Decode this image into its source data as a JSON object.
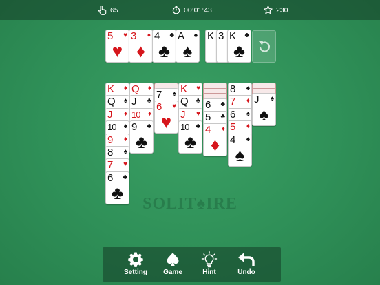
{
  "status": {
    "moves": "65",
    "timer": "00:01:43",
    "score": "230"
  },
  "foundations": [
    {
      "rank": "5",
      "suit": "♥",
      "color": "red"
    },
    {
      "rank": "3",
      "suit": "♦",
      "color": "red"
    },
    {
      "rank": "4",
      "suit": "♣",
      "color": "black"
    },
    {
      "rank": "A",
      "suit": "♠",
      "color": "black"
    }
  ],
  "waste": [
    {
      "rank": "K",
      "suit": "♠",
      "color": "black"
    },
    {
      "rank": "3",
      "suit": "♠",
      "color": "black"
    },
    {
      "rank": "K",
      "suit": "♣",
      "color": "black"
    }
  ],
  "tableau": [
    {
      "hidden": 0,
      "cards": [
        {
          "rank": "K",
          "suit": "♦",
          "color": "red"
        },
        {
          "rank": "Q",
          "suit": "♠",
          "color": "black"
        },
        {
          "rank": "J",
          "suit": "♦",
          "color": "red"
        },
        {
          "rank": "10",
          "suit": "♠",
          "color": "black"
        },
        {
          "rank": "9",
          "suit": "♦",
          "color": "red"
        },
        {
          "rank": "8",
          "suit": "♠",
          "color": "black"
        },
        {
          "rank": "7",
          "suit": "♥",
          "color": "red"
        },
        {
          "rank": "6",
          "suit": "♣",
          "color": "black"
        }
      ]
    },
    {
      "hidden": 0,
      "cards": [
        {
          "rank": "Q",
          "suit": "♦",
          "color": "red"
        },
        {
          "rank": "J",
          "suit": "♣",
          "color": "black"
        },
        {
          "rank": "10",
          "suit": "♦",
          "color": "red"
        },
        {
          "rank": "9",
          "suit": "♣",
          "color": "black"
        }
      ]
    },
    {
      "hidden": 1,
      "cards": [
        {
          "rank": "7",
          "suit": "♠",
          "color": "black"
        },
        {
          "rank": "6",
          "suit": "♥",
          "color": "red"
        }
      ]
    },
    {
      "hidden": 0,
      "cards": [
        {
          "rank": "K",
          "suit": "♥",
          "color": "red"
        },
        {
          "rank": "Q",
          "suit": "♣",
          "color": "black"
        },
        {
          "rank": "J",
          "suit": "♥",
          "color": "red"
        },
        {
          "rank": "10",
          "suit": "♣",
          "color": "black"
        }
      ]
    },
    {
      "hidden": 3,
      "cards": [
        {
          "rank": "6",
          "suit": "♣",
          "color": "black"
        },
        {
          "rank": "5",
          "suit": "♣",
          "color": "black"
        },
        {
          "rank": "4",
          "suit": "♦",
          "color": "red"
        }
      ]
    },
    {
      "hidden": 0,
      "cards": [
        {
          "rank": "8",
          "suit": "♠",
          "color": "black"
        },
        {
          "rank": "7",
          "suit": "♦",
          "color": "red"
        },
        {
          "rank": "6",
          "suit": "♠",
          "color": "black"
        },
        {
          "rank": "5",
          "suit": "♦",
          "color": "red"
        },
        {
          "rank": "4",
          "suit": "♠",
          "color": "black"
        }
      ]
    },
    {
      "hidden": 2,
      "cards": [
        {
          "rank": "J",
          "suit": "♠",
          "color": "black"
        }
      ]
    }
  ],
  "watermark": "SOLIT♠IRE",
  "toolbar": [
    {
      "id": "setting",
      "label": "Setting",
      "icon": "gear-icon"
    },
    {
      "id": "game",
      "label": "Game",
      "icon": "spade-icon"
    },
    {
      "id": "hint",
      "label": "Hint",
      "icon": "lightbulb-icon"
    },
    {
      "id": "undo",
      "label": "Undo",
      "icon": "undo-arrow-icon"
    }
  ],
  "colors": {
    "felt": "#2f9058",
    "red_suit": "#d6161c",
    "black_suit": "#111111"
  }
}
